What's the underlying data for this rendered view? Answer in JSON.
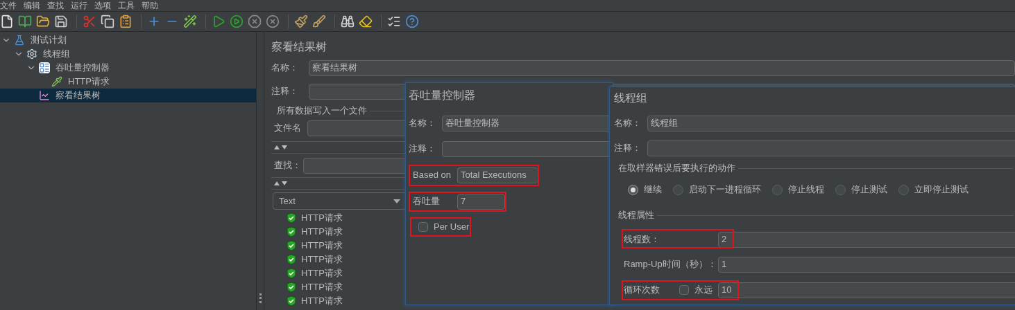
{
  "menu": [
    "文件",
    "编辑",
    "查找",
    "运行",
    "选项",
    "工具",
    "帮助"
  ],
  "tree": [
    {
      "label": "测试计划",
      "kind": "plan",
      "expanded": true,
      "selected": false,
      "children": [
        {
          "label": "线程组",
          "kind": "threads",
          "expanded": true,
          "selected": false,
          "children": [
            {
              "label": "吞吐量控制器",
              "kind": "controller",
              "expanded": true,
              "selected": false,
              "children": [
                {
                  "label": "HTTP请求",
                  "kind": "sampler",
                  "selected": false
                }
              ]
            },
            {
              "label": "察看结果树",
              "kind": "listener",
              "selected": true
            }
          ]
        }
      ]
    }
  ],
  "results_panel": {
    "title": "察看结果树",
    "name_label": "名称：",
    "name_value": "察看结果树",
    "comment_label": "注释：",
    "file_group": "所有数据写入一个文件",
    "filename_label": "文件名",
    "search_label": "查找：",
    "renderer": "Text",
    "results": [
      {
        "label": "HTTP请求"
      },
      {
        "label": "HTTP请求"
      },
      {
        "label": "HTTP请求"
      },
      {
        "label": "HTTP请求"
      },
      {
        "label": "HTTP请求"
      },
      {
        "label": "HTTP请求"
      },
      {
        "label": "HTTP请求"
      }
    ]
  },
  "throughput_panel": {
    "title": "吞吐量控制器",
    "name_label": "名称：",
    "name_value": "吞吐量控制器",
    "comment_label": "注释：",
    "based_on": {
      "label": "Based on",
      "value": "Total Executions",
      "highlighted": true
    },
    "throughput": {
      "label": "吞吐量",
      "value": "7",
      "highlighted": true
    },
    "per_user": {
      "label": "Per User",
      "checked": false,
      "highlighted": true
    }
  },
  "thread_group_panel": {
    "title": "线程组",
    "name_label": "名称：",
    "name_value": "线程组",
    "comment_label": "注释：",
    "error_group": "在取样器错误后要执行的动作",
    "error_actions": [
      {
        "label": "继续",
        "selected": true
      },
      {
        "label": "启动下一进程循环",
        "selected": false
      },
      {
        "label": "停止线程",
        "selected": false
      },
      {
        "label": "停止测试",
        "selected": false
      },
      {
        "label": "立即停止测试",
        "selected": false
      }
    ],
    "props_group": "线程属性",
    "threads": {
      "label": "线程数：",
      "value": "2",
      "highlighted": true
    },
    "ramp_up": {
      "label": "Ramp-Up时间（秒）：",
      "value": "1"
    },
    "loops": {
      "label": "循环次数",
      "forever": {
        "label": "永远",
        "checked": false
      },
      "value": "10",
      "highlighted": true
    }
  }
}
